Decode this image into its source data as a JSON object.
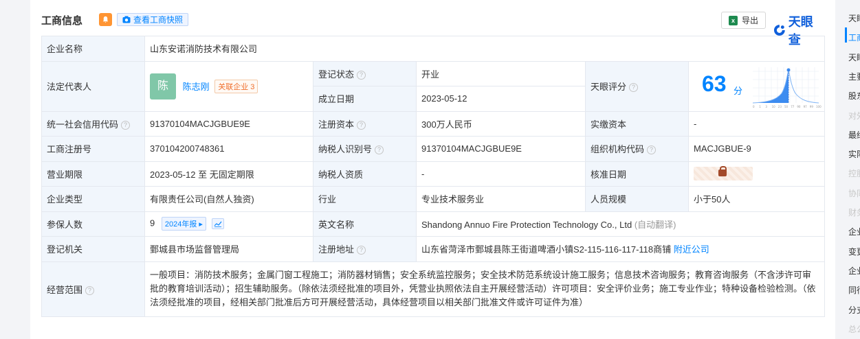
{
  "header": {
    "title": "工商信息",
    "snapshot_label": "查看工商快照",
    "export_label": "导出",
    "brand": "天眼查"
  },
  "rows": {
    "company_name_label": "企业名称",
    "company_name": "山东安诺消防技术有限公司",
    "legal_rep_label": "法定代表人",
    "legal_rep_avatar": "陈",
    "legal_rep_name": "陈志刚",
    "related_label": "关联企业",
    "related_count": "3",
    "reg_status_label": "登记状态",
    "reg_status": "开业",
    "est_date_label": "成立日期",
    "est_date": "2023-05-12",
    "score_label": "天眼评分",
    "score_value": "63",
    "score_unit": "分",
    "credit_code_label": "统一社会信用代码",
    "credit_code": "91370104MACJGBUE9E",
    "reg_capital_label": "注册资本",
    "reg_capital": "300万人民币",
    "paid_capital_label": "实缴资本",
    "paid_capital": "-",
    "reg_no_label": "工商注册号",
    "reg_no": "370104200748361",
    "taxpayer_id_label": "纳税人识别号",
    "taxpayer_id": "91370104MACJGBUE9E",
    "org_code_label": "组织机构代码",
    "org_code": "MACJGBUE-9",
    "term_label": "营业期限",
    "term": "2023-05-12 至 无固定期限",
    "taxpayer_qual_label": "纳税人资质",
    "taxpayer_qual": "-",
    "approve_date_label": "核准日期",
    "type_label": "企业类型",
    "type": "有限责任公司(自然人独资)",
    "industry_label": "行业",
    "industry": "专业技术服务业",
    "staff_label": "人员规模",
    "staff": "小于50人",
    "insured_label": "参保人数",
    "insured": "9",
    "insured_year": "2024年报",
    "en_name_label": "英文名称",
    "en_name": "Shandong Annuo Fire Protection Technology Co., Ltd",
    "en_name_note": "(自动翻译)",
    "authority_label": "登记机关",
    "authority": "鄄城县市场监督管理局",
    "address_label": "注册地址",
    "address": "山东省菏泽市鄄城县陈王街道啤酒小镇S2-115-116-117-118商铺",
    "nearby_label": "附近公司",
    "scope_label": "经营范围",
    "scope": "一般项目：消防技术服务；金属门窗工程施工；消防器材销售；安全系统监控服务；安全技术防范系统设计施工服务；信息技术咨询服务；教育咨询服务（不含涉许可审批的教育培训活动）；招生辅助服务。（除依法须经批准的项目外，凭营业执照依法自主开展经营活动）许可项目：安全评价业务；施工专业作业；特种设备检验检测。（依法须经批准的项目，经相关部门批准后方可开展经营活动，具体经营项目以相关部门批准文件或许可证件为准）"
  },
  "score_chart_axis": [
    "0",
    "1",
    "3",
    "10",
    "23",
    "50",
    "77",
    "90",
    "97",
    "99",
    "100"
  ],
  "sidebar": [
    {
      "label": "天眼",
      "state": "normal"
    },
    {
      "label": "工商",
      "state": "active"
    },
    {
      "label": "天眼",
      "state": "normal"
    },
    {
      "label": "主要",
      "state": "normal"
    },
    {
      "label": "股东",
      "state": "normal"
    },
    {
      "label": "对外",
      "state": "disabled"
    },
    {
      "label": "最终",
      "state": "normal"
    },
    {
      "label": "实际",
      "state": "normal"
    },
    {
      "label": "控股",
      "state": "disabled"
    },
    {
      "label": "协同",
      "state": "disabled"
    },
    {
      "label": "财务",
      "state": "disabled"
    },
    {
      "label": "企业",
      "state": "normal"
    },
    {
      "label": "变更",
      "state": "normal"
    },
    {
      "label": "企业",
      "state": "normal"
    },
    {
      "label": "同行",
      "state": "normal"
    },
    {
      "label": "分支",
      "state": "normal"
    },
    {
      "label": "总公",
      "state": "disabled"
    }
  ],
  "colors": {
    "accent": "#0084ff",
    "label_bg": "#f1f6fc",
    "status_green": "#00a854",
    "bell_orange": "#ff9533",
    "avatar_green": "#80c7a8"
  }
}
